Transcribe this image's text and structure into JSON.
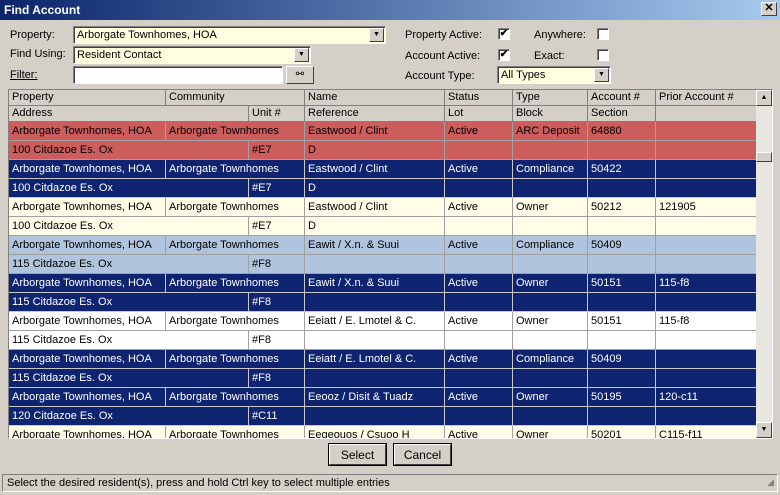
{
  "window": {
    "title": "Find Account",
    "close_glyph": "✕"
  },
  "filters": {
    "property_label": "Property:",
    "property_value": "Arborgate Townhomes, HOA",
    "find_using_label": "Find Using:",
    "find_using_value": "Resident Contact",
    "filter_label": "Filter:",
    "filter_value": "",
    "property_active_label": "Property Active:",
    "property_active_checked": "✔",
    "account_active_label": "Account Active:",
    "account_active_checked": "✔",
    "anywhere_label": "Anywhere:",
    "anywhere_checked": "",
    "exact_label": "Exact:",
    "exact_checked": "",
    "account_type_label": "Account Type:",
    "account_type_value": "All Types",
    "search_icon": "binoculars-icon",
    "search_glyph": "⚯",
    "dropdown_glyph": "▼"
  },
  "grid": {
    "headers_top": [
      "Property",
      "Community",
      "Name",
      "Status",
      "Type",
      "Account #",
      "Prior Account #"
    ],
    "headers_bottom": [
      "Address",
      "Unit #",
      "Reference",
      "Lot",
      "Block",
      "Section"
    ],
    "rows": [
      {
        "style": "red",
        "top": {
          "property": "Arborgate Townhomes, HOA",
          "community": "Arborgate Townhomes",
          "name": "Eastwood / Clint",
          "status": "Active",
          "type": "ARC Deposit",
          "account": "64880",
          "prior": ""
        },
        "bottom": {
          "address": "100 Citdazoe Es. Ox",
          "unit": "#E7",
          "reference": "D",
          "lot": "",
          "block": "",
          "section": ""
        }
      },
      {
        "style": "navy",
        "top": {
          "property": "Arborgate Townhomes, HOA",
          "community": "Arborgate Townhomes",
          "name": "Eastwood / Clint",
          "status": "Active",
          "type": "Compliance",
          "account": "50422",
          "prior": ""
        },
        "bottom": {
          "address": "100 Citdazoe Es. Ox",
          "unit": "#E7",
          "reference": "D",
          "lot": "",
          "block": "",
          "section": ""
        }
      },
      {
        "style": "cream",
        "top": {
          "property": "Arborgate Townhomes, HOA",
          "community": "Arborgate Townhomes",
          "name": "Eastwood / Clint",
          "status": "Active",
          "type": "Owner",
          "account": "50212",
          "prior": "121905"
        },
        "bottom": {
          "address": "100 Citdazoe Es. Ox",
          "unit": "#E7",
          "reference": "D",
          "lot": "",
          "block": "",
          "section": ""
        }
      },
      {
        "style": "blue",
        "top": {
          "property": "Arborgate Townhomes, HOA",
          "community": "Arborgate Townhomes",
          "name": "Eawit / X.n. & Suui",
          "status": "Active",
          "type": "Compliance",
          "account": "50409",
          "prior": ""
        },
        "bottom": {
          "address": "115 Citdazoe Es. Ox",
          "unit": "#F8",
          "reference": "",
          "lot": "",
          "block": "",
          "section": ""
        }
      },
      {
        "style": "navy",
        "top": {
          "property": "Arborgate Townhomes, HOA",
          "community": "Arborgate Townhomes",
          "name": "Eawit / X.n. & Suui",
          "status": "Active",
          "type": "Owner",
          "account": "50151",
          "prior": "115-f8"
        },
        "bottom": {
          "address": "115 Citdazoe Es. Ox",
          "unit": "#F8",
          "reference": "",
          "lot": "",
          "block": "",
          "section": ""
        }
      },
      {
        "style": "white",
        "top": {
          "property": "Arborgate Townhomes, HOA",
          "community": "Arborgate Townhomes",
          "name": "Eeiatt / E. Lmotel & C.",
          "status": "Active",
          "type": "Owner",
          "account": "50151",
          "prior": "115-f8"
        },
        "bottom": {
          "address": "115 Citdazoe Es. Ox",
          "unit": "#F8",
          "reference": "",
          "lot": "",
          "block": "",
          "section": ""
        }
      },
      {
        "style": "navy",
        "top": {
          "property": "Arborgate Townhomes, HOA",
          "community": "Arborgate Townhomes",
          "name": "Eeiatt / E. Lmotel & C.",
          "status": "Active",
          "type": "Compliance",
          "account": "50409",
          "prior": ""
        },
        "bottom": {
          "address": "115 Citdazoe Es. Ox",
          "unit": "#F8",
          "reference": "",
          "lot": "",
          "block": "",
          "section": ""
        }
      },
      {
        "style": "navy",
        "top": {
          "property": "Arborgate Townhomes, HOA",
          "community": "Arborgate Townhomes",
          "name": "Eeooz / Disit & Tuadz",
          "status": "Active",
          "type": "Owner",
          "account": "50195",
          "prior": "120-c11"
        },
        "bottom": {
          "address": "120 Citdazoe Es. Ox",
          "unit": "#C11",
          "reference": "",
          "lot": "",
          "block": "",
          "section": ""
        }
      },
      {
        "style": "cream",
        "top": {
          "property": "Arborgate Townhomes, HOA",
          "community": "Arborgate Townhomes",
          "name": "Eegeouos / Csuoo H",
          "status": "Active",
          "type": "Owner",
          "account": "50201",
          "prior": "C115-f11"
        },
        "bottom": {
          "address": "",
          "unit": "",
          "reference": "",
          "lot": "",
          "block": "",
          "section": ""
        }
      }
    ]
  },
  "buttons": {
    "select": "Select",
    "cancel": "Cancel"
  },
  "status_text": "Select the desired resident(s), press and hold Ctrl key to select multiple entries",
  "scroll": {
    "up_glyph": "▲",
    "down_glyph": "▼"
  }
}
